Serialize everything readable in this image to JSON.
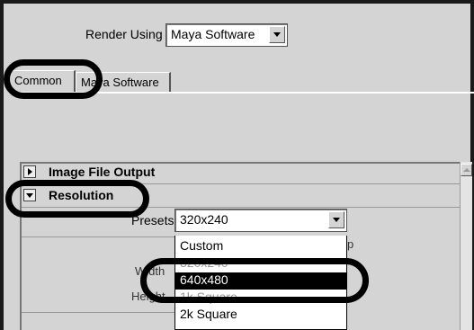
{
  "render_settings": {
    "render_using_label": "Render Using",
    "renderer_value": "Maya Software"
  },
  "tabs": [
    {
      "label": "Common"
    },
    {
      "label": "Maya Software"
    }
  ],
  "sections": {
    "image_file_output": "Image File Output",
    "resolution": "Resolution"
  },
  "resolution": {
    "presets_label": "Presets",
    "presets_value": "320x240",
    "width_label": "Width",
    "height_label": "Height",
    "obscured_text": "p"
  },
  "presets_dropdown": {
    "options": [
      "Custom",
      "320x240",
      "640x480",
      "1k Square",
      "2k Square"
    ],
    "selected": "640x480"
  },
  "colors": {
    "background": "#d4d4d4",
    "highlight": "#000000",
    "annotation": "#000000"
  }
}
